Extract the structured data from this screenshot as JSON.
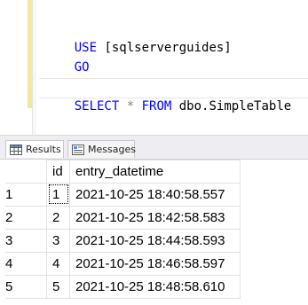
{
  "editor": {
    "lines": [
      {
        "keyword": "USE",
        "rest": " [sqlserverguides]"
      },
      {
        "keyword": "GO",
        "rest": ""
      },
      {
        "keyword": "SELECT",
        "star": " * ",
        "keyword2": "FROM",
        "rest": " dbo.SimpleTable"
      }
    ]
  },
  "tabs": {
    "results_label": "Results",
    "messages_label": "Messages"
  },
  "grid": {
    "columns": [
      "id",
      "entry_datetime"
    ],
    "rows": [
      {
        "num": "1",
        "id": "1",
        "entry_datetime": "2021-10-25 18:40:58.557"
      },
      {
        "num": "2",
        "id": "2",
        "entry_datetime": "2021-10-25 18:42:58.583"
      },
      {
        "num": "3",
        "id": "3",
        "entry_datetime": "2021-10-25 18:44:58.593"
      },
      {
        "num": "4",
        "id": "4",
        "entry_datetime": "2021-10-25 18:46:58.597"
      },
      {
        "num": "5",
        "id": "5",
        "entry_datetime": "2021-10-25 18:48:58.610"
      }
    ]
  },
  "colors": {
    "keyword": "#0000ff",
    "operator": "#808080",
    "change_indicator": "#f1e79d"
  },
  "icons": {
    "results_tab": "grid-icon",
    "messages_tab": "messages-icon"
  }
}
